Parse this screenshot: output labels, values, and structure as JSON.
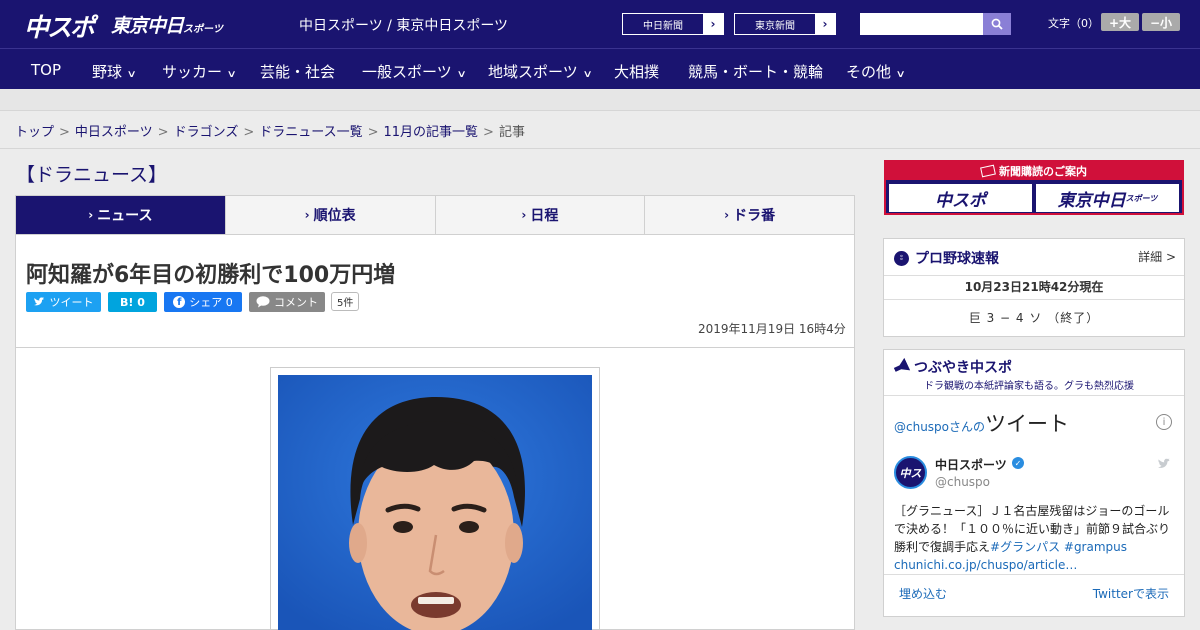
{
  "header": {
    "logo_main": "中スポ",
    "logo_tokyo": "東京中日",
    "logo_tokyo_small": "スポーツ",
    "site_link": "中日スポーツ / 東京中日スポーツ",
    "paper_btn_1": "中日新聞",
    "paper_btn_2": "東京新聞",
    "search_placeholder": "",
    "fontsize_label": "文字（0）",
    "fontsize_up": "+大",
    "fontsize_down": "−小"
  },
  "nav": {
    "items": [
      {
        "label": "TOP",
        "has_menu": false
      },
      {
        "label": "野球",
        "has_menu": true
      },
      {
        "label": "サッカー",
        "has_menu": true
      },
      {
        "label": "芸能・社会",
        "has_menu": false
      },
      {
        "label": "一般スポーツ",
        "has_menu": true
      },
      {
        "label": "地域スポーツ",
        "has_menu": true
      },
      {
        "label": "大相撲",
        "has_menu": false
      },
      {
        "label": "競馬・ボート・競輪",
        "has_menu": false
      },
      {
        "label": "その他",
        "has_menu": true
      }
    ]
  },
  "breadcrumb": {
    "items": [
      "トップ",
      "中日スポーツ",
      "ドラゴンズ",
      "ドラニュース一覧",
      "11月の記事一覧"
    ],
    "current": "記事",
    "separator": ">"
  },
  "section": {
    "title": "【ドラニュース】",
    "tabs": [
      {
        "label": "ニュース",
        "active": true
      },
      {
        "label": "順位表",
        "active": false
      },
      {
        "label": "日程",
        "active": false
      },
      {
        "label": "ドラ番",
        "active": false
      }
    ]
  },
  "article": {
    "headline": "阿知羅が6年目の初勝利で100万円増",
    "share": {
      "tweet": "ツイート",
      "hatena": "B! 0",
      "facebook": "シェア 0",
      "comment": "コメント",
      "comment_count": "5件"
    },
    "date": "2019年11月19日 16時4分"
  },
  "sidebar": {
    "subscribe_title": "新聞購読のご案内",
    "subscribe_logo_1": "中スポ",
    "subscribe_logo_2": "東京中日",
    "subscribe_logo_2_small": "スポーツ",
    "pro_baseball": {
      "title": "プロ野球速報",
      "detail": "詳細 >",
      "time": "10月23日21時42分現在",
      "score": "巨 3 − 4 ソ （終了）"
    },
    "tweets": {
      "title": "つぶやき中スポ",
      "subtitle": "ドラ観戦の本紙評論家も語る。グラも熱烈応援",
      "heading_prefix": "@chuspoさんの",
      "heading_big": "ツイート",
      "name": "中日スポーツ",
      "handle": "@chuspo",
      "text": "［グラニュース］Ｊ１名古屋残留はジョーのゴールで決める！「１００％に近い動き」前節９試合ぶり勝利で復調手応え",
      "hashtags": "#グランパス #grampus",
      "link": "chunichi.co.jp/chuspo/article…",
      "embed": "埋め込む",
      "view_on_twitter": "Twitterで表示"
    }
  },
  "colors": {
    "brand_navy": "#1a1470",
    "accent_red": "#d0103a",
    "twitter_blue": "#1da1f2",
    "hatena_blue": "#00a4de",
    "facebook_blue": "#1877f2",
    "comment_gray": "#888888"
  }
}
